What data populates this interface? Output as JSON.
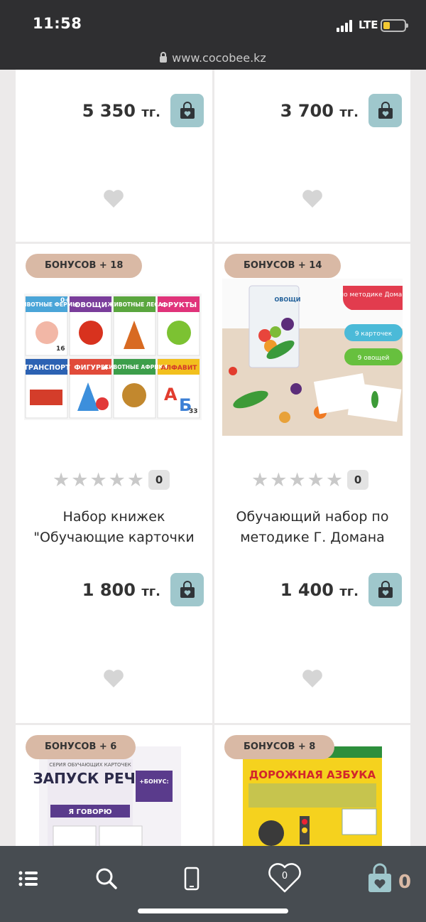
{
  "status_bar": {
    "time": "11:58",
    "network": "LTE"
  },
  "url_bar": {
    "url": "www.cocobee.kz"
  },
  "products": [
    {
      "price": "5 350",
      "currency": "тг."
    },
    {
      "price": "3 700",
      "currency": "тг."
    },
    {
      "bonus": "БОНУСОВ + 18",
      "rating_count": "0",
      "title": "Набор книжек \"Обучающие карточки",
      "price": "1 800",
      "currency": "тг.",
      "cover_labels": [
        "ЖИВОТНЫЕ ФЕРМЫ",
        "ОВОЩИ",
        "ЖИВОТНЫЕ ЛЕСА",
        "ФРУКТЫ",
        "ТРАНСПОРТ",
        "ФИГУРЫ",
        "ЖИВОТНЫЕ АФРИКИ",
        "АЛФАВИТ"
      ],
      "cover_small": [
        "0+",
        "16",
        "33"
      ]
    },
    {
      "bonus": "БОНУСОВ + 14",
      "rating_count": "0",
      "title": "Обучающий набор по методике Г. Домана",
      "price": "1 400",
      "currency": "тг.",
      "tags": [
        "по методике Домана",
        "9 карточек",
        "9 овощей"
      ],
      "pack_label": "ОВОЩИ"
    },
    {
      "bonus": "БОНУСОВ + 6",
      "cover_title": "ЗАПУСК РЕЧИ",
      "cover_series": "СЕРИЯ ОБУЧАЮЩИХ КАРТОЧЕК",
      "cover_bonus": "+БОНУС:",
      "cover_sub": "Я ГОВОРЮ"
    },
    {
      "bonus": "БОНУСОВ + 8",
      "cover_title": "ДОРОЖНАЯ АЗБУКА"
    }
  ],
  "bottom_nav": {
    "favorites_count": "0",
    "cart_count": "0"
  },
  "colors": {
    "cart_button": "#9fc7cc",
    "badge": "#d9b9a5",
    "bar": "#474c51"
  }
}
